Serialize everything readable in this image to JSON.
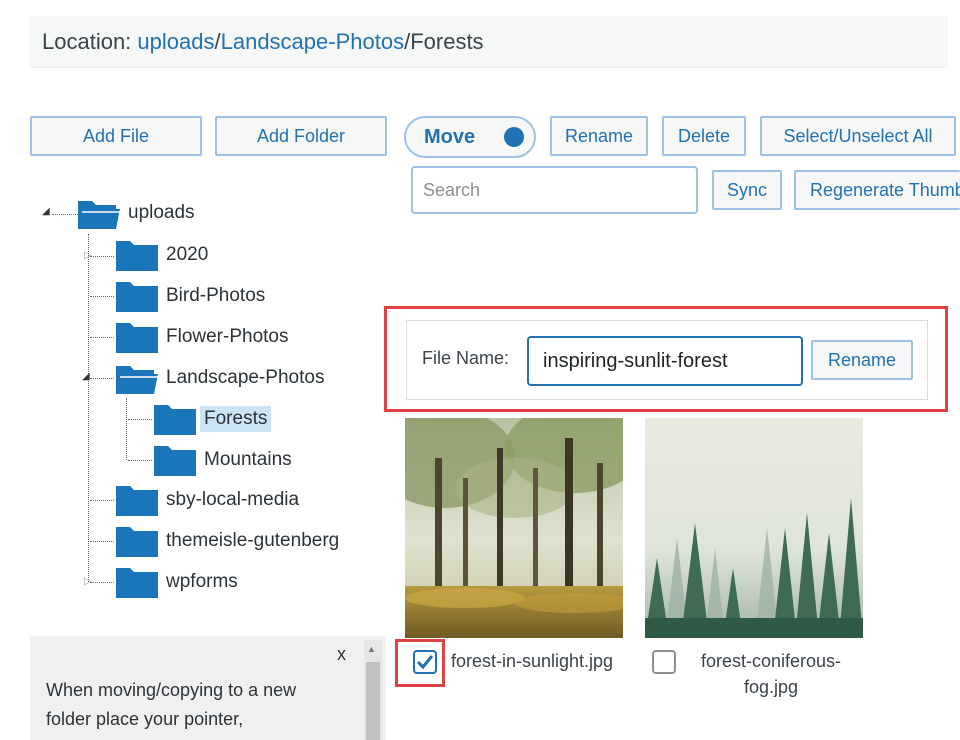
{
  "location": {
    "prefix": "Location: ",
    "crumbs": [
      "uploads",
      "Landscape-Photos"
    ],
    "separator": "/",
    "current": "Forests"
  },
  "toolbar": {
    "add_file": "Add File",
    "add_folder": "Add Folder",
    "move": "Move",
    "rename": "Rename",
    "delete": "Delete",
    "select_all": "Select/Unselect All",
    "sync": "Sync",
    "regenerate": "Regenerate Thumbnails",
    "search_placeholder": "Search"
  },
  "tree": {
    "root": "uploads",
    "items": [
      "2020",
      "Bird-Photos",
      "Flower-Photos",
      "Landscape-Photos",
      "sby-local-media",
      "themeisle-gutenberg",
      "wpforms"
    ],
    "children": [
      "Forests",
      "Mountains"
    ]
  },
  "rename_panel": {
    "label": "File Name:",
    "value": "inspiring-sunlit-forest",
    "button": "Rename"
  },
  "files": [
    {
      "caption": "forest-in-sunlight.jpg",
      "checked": true
    },
    {
      "caption": "forest-coniferous-fog.jpg",
      "checked": false
    }
  ],
  "help": {
    "close": "x",
    "text": "When moving/copying to a new folder place your pointer,"
  },
  "colors": {
    "accent": "#2271b1",
    "folder": "#1b75bb",
    "highlight": "#e04040",
    "selected": "#cce5f6"
  }
}
